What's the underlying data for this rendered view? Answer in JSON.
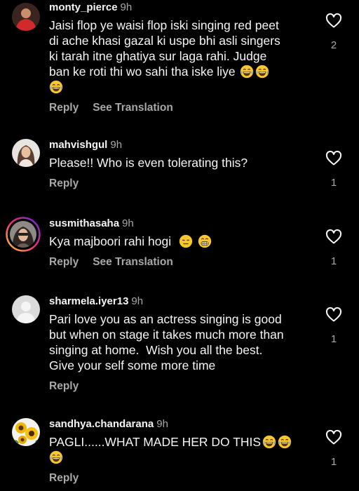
{
  "comments": [
    {
      "username": "monty_pierce",
      "time": "9h",
      "lines": [
        "Jaisi flop ye waisi flop iski singing red peet",
        "di ache khasi gazal ki uspe bhi asli singers",
        "ki tarah itne ghatiya sur laga rahi. Judge",
        "ban ke roti thi wo sahi tha iske liye"
      ],
      "reply_label": "Reply",
      "translate_label": "See Translation",
      "likes": "2",
      "avatar_icon": "user-avatar-red-hoodie"
    },
    {
      "username": "mahvishgul",
      "time": "9h",
      "lines": [
        "Please!! Who is even tolerating this?"
      ],
      "reply_label": "Reply",
      "likes": "1",
      "avatar_icon": "user-avatar-woman-photo"
    },
    {
      "username": "susmithasaha",
      "time": "9h",
      "lines": [
        "Kya majboori rahi hogi"
      ],
      "reply_label": "Reply",
      "translate_label": "See Translation",
      "likes": "1",
      "avatar_icon": "user-avatar-story-ring"
    },
    {
      "username": "sharmela.iyer13",
      "time": "9h",
      "lines": [
        "Pari love you as an actress singing is good",
        "but when on stage it takes much more than",
        "singing at home.  Wish you all the best.",
        "Give your self some more time"
      ],
      "reply_label": "Reply",
      "likes": "1",
      "avatar_icon": "default-avatar-icon"
    },
    {
      "username": "sandhya.chandarana",
      "time": "9h",
      "lines": [
        "PAGLI......WHAT MADE HER DO THIS"
      ],
      "reply_label": "Reply",
      "likes": "1",
      "avatar_icon": "user-avatar-sunflowers"
    }
  ],
  "colors": {
    "background": "#000000",
    "text": "#f5f5f5",
    "secondary": "#a8a8a8"
  }
}
